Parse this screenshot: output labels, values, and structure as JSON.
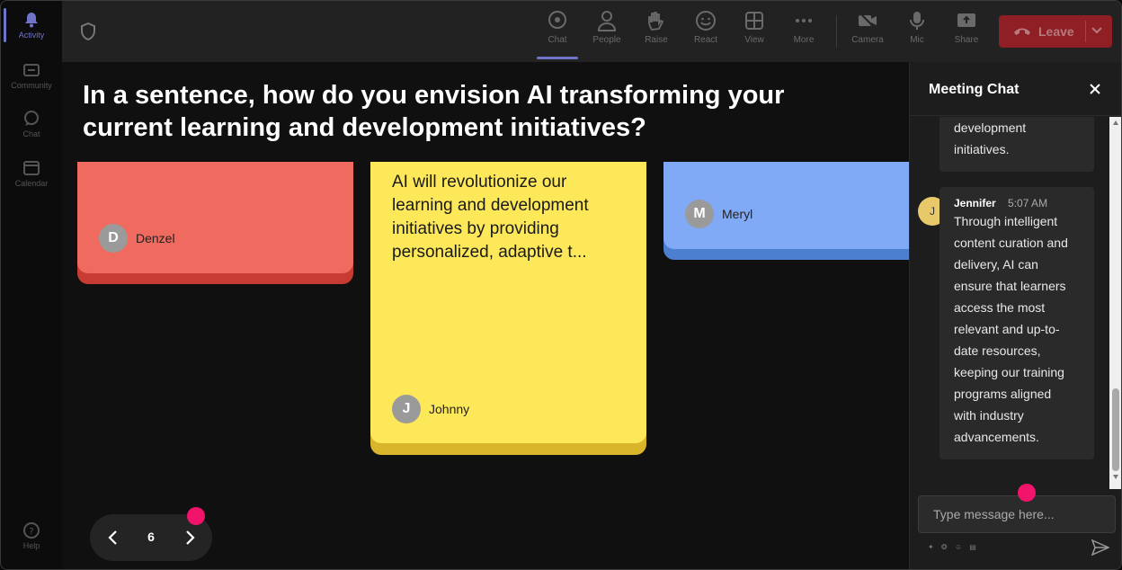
{
  "rail": {
    "items": [
      {
        "label": "Activity"
      },
      {
        "label": "Community"
      },
      {
        "label": "Chat"
      },
      {
        "label": "Calendar"
      },
      {
        "label": "Help"
      }
    ]
  },
  "toolbar": {
    "items": [
      {
        "label": "Chat",
        "icon": "chat-icon"
      },
      {
        "label": "People",
        "icon": "people-icon"
      },
      {
        "label": "Raise",
        "icon": "raise-hand-icon"
      },
      {
        "label": "React",
        "icon": "react-icon"
      },
      {
        "label": "View",
        "icon": "view-icon"
      },
      {
        "label": "More",
        "icon": "more-icon"
      },
      {
        "label": "Camera",
        "icon": "camera-off-icon"
      },
      {
        "label": "Mic",
        "icon": "mic-icon"
      },
      {
        "label": "Share",
        "icon": "share-icon"
      }
    ],
    "leave_label": "Leave"
  },
  "main": {
    "question": "In a sentence, how do you envision AI transforming your current learning and development initiatives?",
    "cards": [
      {
        "color": "#ef6a5f",
        "text": "",
        "author": "Denzel",
        "initial": "D"
      },
      {
        "color": "#fde85a",
        "text": "AI will revolutionize our learning and development initiatives by providing personalized, adaptive t...",
        "author": "Johnny",
        "initial": "J"
      },
      {
        "color": "#80aaf5",
        "text": "",
        "author": "Meryl",
        "initial": "M"
      }
    ],
    "pager": {
      "page": "6"
    }
  },
  "chat": {
    "title": "Meeting Chat",
    "messages": [
      {
        "text_lines": [
          "development",
          "initiatives."
        ]
      },
      {
        "author": "Jennifer",
        "initial": "J",
        "time": "5:07 AM",
        "text_lines": [
          "Through intelligent",
          "content curation and",
          "delivery, AI can",
          "ensure that learners",
          "access the most",
          "relevant and up-to-",
          "date resources,",
          "keeping our training",
          "programs aligned",
          "with industry",
          "advancements."
        ]
      }
    ],
    "input_placeholder": "Type message here...",
    "format_icons": "✦ ❂ ☺ ▤"
  },
  "colors": {
    "accent": "#6f74c8",
    "leave": "#8f1e25",
    "highlight_dot": "#f2136b"
  }
}
